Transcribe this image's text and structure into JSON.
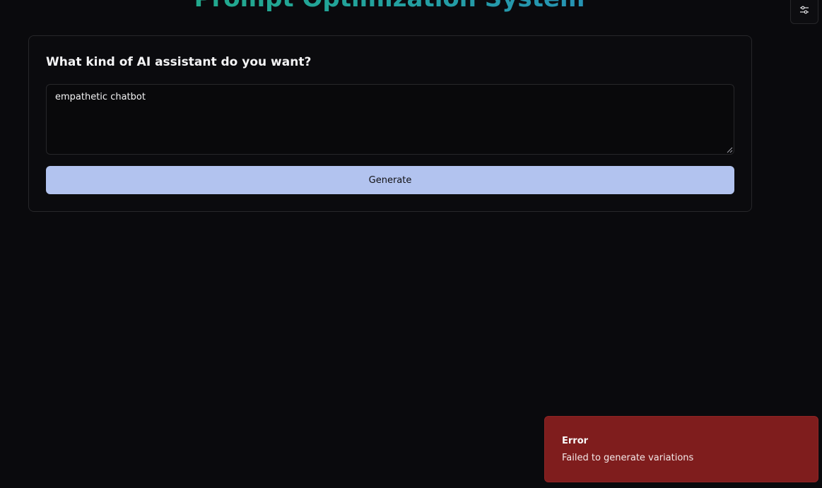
{
  "header": {
    "title": "Prompt Optimization System"
  },
  "settings": {
    "icon": "sliders-icon"
  },
  "form": {
    "question": "What kind of AI assistant do you want?",
    "input_value": "empathetic chatbot",
    "generate_label": "Generate"
  },
  "toast": {
    "title": "Error",
    "message": "Failed to generate variations"
  },
  "colors": {
    "background": "#0a0a0d",
    "title_gradient_start": "#22b07a",
    "title_gradient_end": "#2a86c9",
    "button": "#b2c3ef",
    "toast": "#7f1d1d"
  }
}
